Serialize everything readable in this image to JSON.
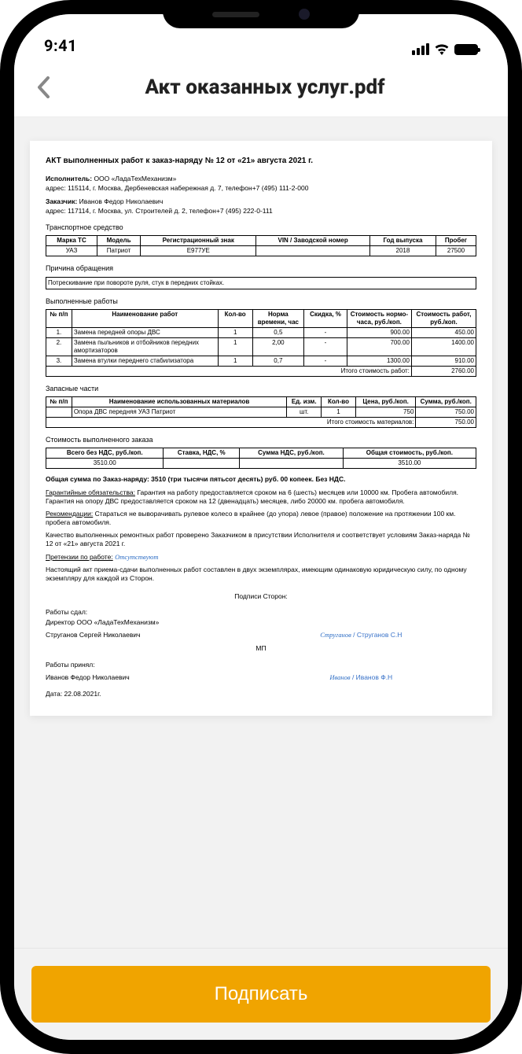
{
  "status": {
    "time": "9:41"
  },
  "header": {
    "title": "Акт оказанных услуг.pdf"
  },
  "footer": {
    "sign_label": "Подписать"
  },
  "doc": {
    "title": "АКТ выполненных работ к заказ-наряду № 12 от «21» августа 2021 г.",
    "executor_label": "Исполнитель:",
    "executor_name": "ООО «ЛадаТехМеханизм»",
    "executor_addr": "адрес: 115114, г. Москва, Дербеневская набережная д. 7, телефон+7 (495) 111-2-000",
    "customer_label": "Заказчик:",
    "customer_name": "Иванов Федор Николаевич",
    "customer_addr": "адрес: 117114, г. Москва, ул. Строителей д. 2, телефон+7 (495) 222-0-111",
    "vehicle_h": "Транспортное средство",
    "vehicle_headers": [
      "Марка ТС",
      "Модель",
      "Регистрационный знак",
      "VIN / Заводской номер",
      "Год выпуска",
      "Пробег"
    ],
    "vehicle_row": [
      "УАЗ",
      "Патриот",
      "Е977УЕ",
      "",
      "2018",
      "27500"
    ],
    "reason_h": "Причина обращения",
    "reason_text": "Потрескивание при повороте руля, стук в передних стойках.",
    "works_h": "Выполненные работы",
    "works_headers": [
      "№ п/п",
      "Наименование работ",
      "Кол-во",
      "Норма времени, час",
      "Скидка, %",
      "Стоимость нормо-часа, руб./коп.",
      "Стоимость работ, руб./коп."
    ],
    "works_rows": [
      [
        "1.",
        "Замена передней опоры ДВС",
        "1",
        "0,5",
        "-",
        "900.00",
        "450.00"
      ],
      [
        "2.",
        "Замена пыльников и отбойников передних амортизаторов",
        "1",
        "2,00",
        "-",
        "700.00",
        "1400.00"
      ],
      [
        "3.",
        "Замена втулки переднего стабилизатора",
        "1",
        "0,7",
        "-",
        "1300.00",
        "910.00"
      ]
    ],
    "works_total_label": "Итого стоимость работ:",
    "works_total": "2760.00",
    "parts_h": "Запасные части",
    "parts_headers": [
      "№ п/п",
      "Наименование использованных материалов",
      "Ед. изм.",
      "Кол-во",
      "Цена, руб./коп.",
      "Сумма, руб./коп."
    ],
    "parts_rows": [
      [
        "",
        "Опора ДВС передняя УАЗ Патриот",
        "шт.",
        "1",
        "750",
        "750.00"
      ]
    ],
    "parts_total_label": "Итого стоимость материалов:",
    "parts_total": "750.00",
    "cost_h": "Стоимость выполненного заказа",
    "cost_headers": [
      "Всего без НДС, руб./коп.",
      "Ставка, НДС, %",
      "Сумма НДС, руб./коп.",
      "Общая стоимость, руб./коп."
    ],
    "cost_row": [
      "3510.00",
      "",
      "",
      "3510.00"
    ],
    "grand_total": "Общая сумма по Заказ-наряду: 3510 (три тысячи пятьсот десять) руб. 00 копеек. Без НДС.",
    "warranty_label": "Гарантийные обязательства:",
    "warranty_text": " Гарантия на работу предоставляется сроком на 6 (шесть) месяцев или 10000 км. Пробега автомобиля. Гарантия на опору ДВС предоставляется сроком на 12 (двенадцать) месяцев, либо 20000 км. пробега автомобиля.",
    "recom_label": "Рекомендации:",
    "recom_text": " Стараться не выворачивать рулевое колесо в крайнее (до упора) левое (правое) положение на протяжении 100 км. пробега автомобиля.",
    "quality": "Качество выполненных ремонтных работ проверено Заказчиком в присутствии Исполнителя и соответствует условиям Заказ-наряда № 12 от «21» августа 2021 г.",
    "claims_label": "Претензии по работе:",
    "claims_value": "Отсутствуют",
    "copies": "Настоящий акт приема-сдачи выполненных работ составлен в двух экземплярах, имеющим одинаковую юридическую силу, по одному экземпляру для каждой из Сторон.",
    "sig_title": "Подписи Сторон:",
    "submitted_by_label": "Работы сдал:",
    "director": "Директор ООО «ЛадаТехМеханизм»",
    "director_name": "Струганов Сергей Николаевич",
    "sig1_script": "Струганов",
    "sig1_print": "Струганов С.Н",
    "mp": "МП",
    "accepted_by_label": "Работы принял:",
    "accepted_name": "Иванов Федор Николаевич",
    "sig2_script": "Иванов",
    "sig2_print": "Иванов Ф.Н",
    "date": "Дата: 22.08.2021г."
  }
}
